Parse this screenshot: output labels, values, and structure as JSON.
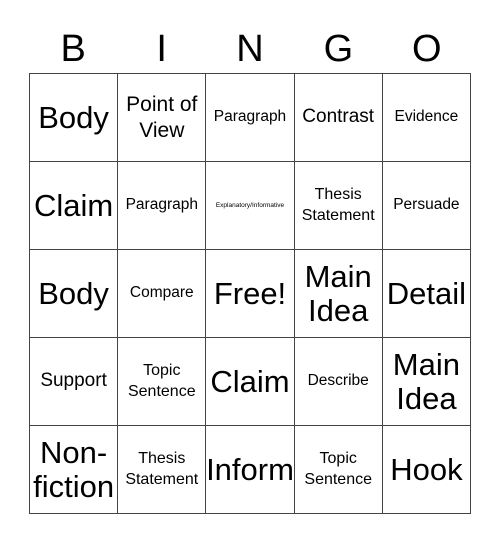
{
  "header": [
    "B",
    "I",
    "N",
    "G",
    "O"
  ],
  "cells": [
    [
      "Body",
      "Point of View",
      "Paragraph",
      "Contrast",
      "Evidence"
    ],
    [
      "Claim",
      "Paragraph",
      "Explanatory/Informative",
      "Thesis Statement",
      "Persuade"
    ],
    [
      "Body",
      "Compare",
      "Free!",
      "Main Idea",
      "Detail"
    ],
    [
      "Support",
      "Topic Sentence",
      "Claim",
      "Describe",
      "Main Idea"
    ],
    [
      "Non-fiction",
      "Thesis Statement",
      "Inform",
      "Topic Sentence",
      "Hook"
    ]
  ]
}
